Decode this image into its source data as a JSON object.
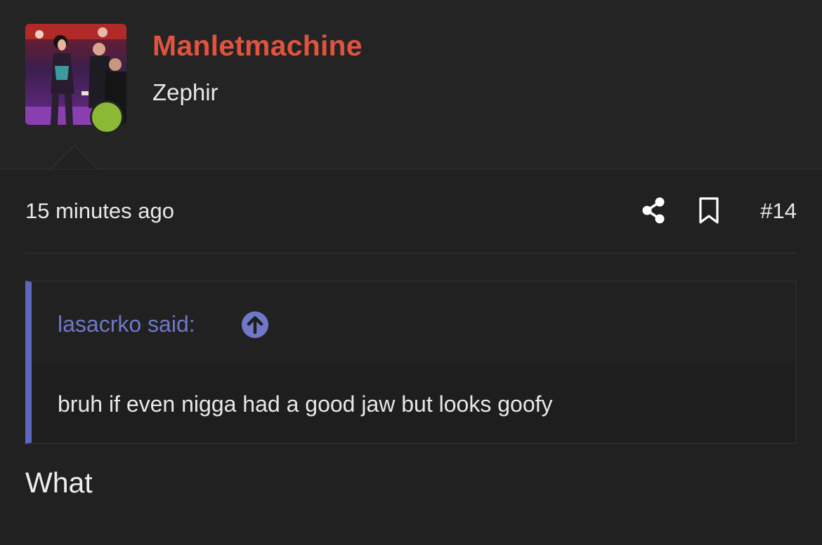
{
  "user": {
    "name": "Manletmachine",
    "title": "Zephir",
    "online": true
  },
  "post": {
    "time": "15 minutes ago",
    "number": "#14",
    "message": "What"
  },
  "quote": {
    "author": "lasacrko said:",
    "text": "bruh if even nigga had a good jaw but looks goofy"
  },
  "icons": {
    "share": "share-icon",
    "bookmark": "bookmark-icon",
    "jump": "arrow-up-circle-icon"
  },
  "colors": {
    "background": "#212121",
    "username": "#e0533f",
    "online": "#8bb935",
    "quote_accent": "#5c67c0",
    "quote_author": "#6f78c8"
  }
}
